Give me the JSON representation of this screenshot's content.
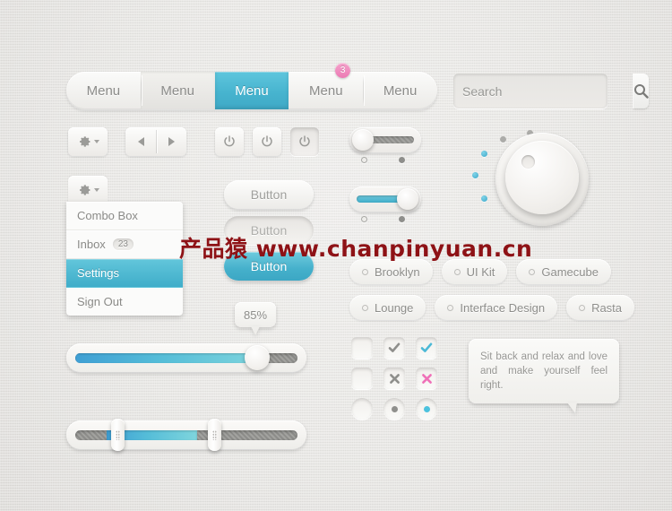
{
  "menubar": {
    "items": [
      {
        "label": "Menu",
        "state": "normal"
      },
      {
        "label": "Menu",
        "state": "hover"
      },
      {
        "label": "Menu",
        "state": "active"
      },
      {
        "label": "Menu",
        "state": "badge",
        "badge": "3"
      },
      {
        "label": "Menu",
        "state": "normal"
      }
    ]
  },
  "search": {
    "placeholder": "Search",
    "value": "",
    "button_icon": "search-icon"
  },
  "toolbar": {
    "gear_icon": "gear-icon",
    "caret_icon": "chevron-down-icon",
    "prev_icon": "arrow-left-icon",
    "next_icon": "arrow-right-icon",
    "power_icon": "power-icon"
  },
  "dropdown": {
    "trigger_icon": "gear-icon",
    "items": [
      {
        "label": "Combo Box",
        "count": "",
        "selected": false
      },
      {
        "label": "Inbox",
        "count": "23",
        "selected": false
      },
      {
        "label": "Settings",
        "count": "",
        "selected": true
      },
      {
        "label": "Sign Out",
        "count": "",
        "selected": false
      }
    ]
  },
  "buttons": [
    {
      "label": "Button",
      "style": "normal"
    },
    {
      "label": "Button",
      "style": "pressed"
    },
    {
      "label": "Button",
      "style": "blue"
    }
  ],
  "toggles": [
    {
      "position": "left",
      "fill": "grey"
    },
    {
      "position": "right",
      "fill": "blue"
    }
  ],
  "knob": {
    "name": "rotary-knob",
    "accent_color": "#3fa9c9",
    "dot_color": "#acaca9"
  },
  "tags": {
    "row1": [
      "Brooklyn",
      "UI Kit",
      "Gamecube"
    ],
    "row2": [
      "Lounge",
      "Interface Design",
      "Rasta"
    ]
  },
  "checkboxes": [
    {
      "type": "checkbox",
      "state": "empty",
      "mark": ""
    },
    {
      "type": "checkbox",
      "state": "checked-grey",
      "mark": "✔"
    },
    {
      "type": "checkbox",
      "state": "checked-blue",
      "mark": "✔"
    },
    {
      "type": "checkbox",
      "state": "empty",
      "mark": ""
    },
    {
      "type": "checkbox",
      "state": "cross-grey",
      "mark": "✖"
    },
    {
      "type": "checkbox",
      "state": "cross-pink",
      "mark": "✖"
    },
    {
      "type": "radio",
      "state": "empty",
      "mark": ""
    },
    {
      "type": "radio",
      "state": "selected-grey",
      "mark": "●"
    },
    {
      "type": "radio",
      "state": "selected-blue",
      "mark": "●"
    }
  ],
  "colors": {
    "accent_blue": "#45b0cb",
    "accent_pink": "#ec79b4",
    "check_grey": "#8f8f8c",
    "text_grey": "#8c8c8a",
    "background": "#e9e8e6"
  },
  "tooltip": {
    "text": "Sit back and relax and love and make yourself feel right."
  },
  "slider_bubble": {
    "value": "85%"
  },
  "sliders": {
    "single": {
      "fill_percent": 85
    },
    "range": {
      "start_percent": 14,
      "end_percent": 55
    }
  },
  "watermark": {
    "text": "产品猿  www.chanpinyuan.cn"
  }
}
